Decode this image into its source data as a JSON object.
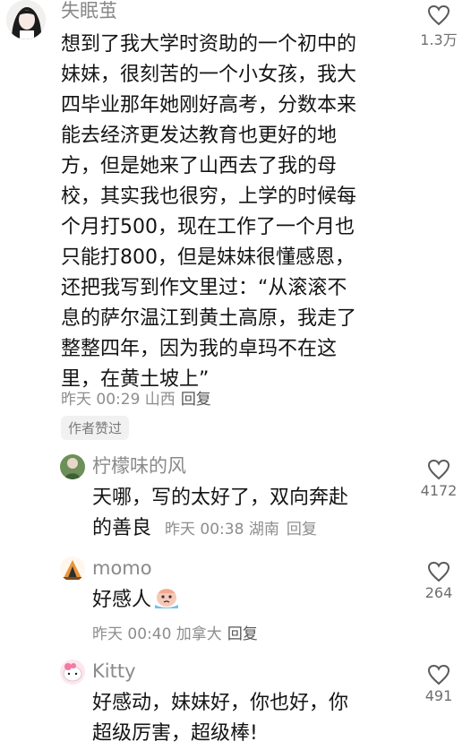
{
  "main_comment": {
    "username": "失眠茧",
    "lines": [
      "想到了我大学时资助的一个初中的",
      "妹妹，很刻苦的一个小女孩，我大",
      "四毕业那年她刚好高考，分数本来",
      "能去经济更发达教育也更好的地",
      "方，但是她来了山西去了我的母",
      "校，其实我也很穷，上学的时候每",
      "个月打500，现在工作了一个月也",
      "只能打800，但是妹妹很懂感恩，",
      "还把我写到作文里过：“从滚滚不",
      "息的萨尔温江到黄土高原，我走了",
      "整整四年，因为我的卓玛不在这",
      "里，在黄土坡上”"
    ],
    "meta": "昨天 00:29 山西",
    "reply_label": "回复",
    "likes": "1.3万",
    "badge": "作者赞过"
  },
  "replies": [
    {
      "username": "柠檬味的风",
      "line1": "天哪，写的太好了，双向奔赴",
      "line2_text": "的善良",
      "meta": "昨天 00:38 湖南",
      "reply_label": "回复",
      "likes": "4172"
    },
    {
      "username": "momo",
      "text": "好感人",
      "emoji": "crying-face-emoji",
      "meta": "昨天 00:40 加拿大",
      "reply_label": "回复",
      "likes": "264"
    },
    {
      "username": "Kitty",
      "line1": "好感动，妹妹好，你也好，你",
      "line2": "超级厉害，超级棒!",
      "likes": "491"
    }
  ],
  "colors": {
    "username": "#8a8a8a",
    "text": "#141414",
    "meta": "#8d8d8d",
    "badge_bg": "#f1f1f1"
  }
}
